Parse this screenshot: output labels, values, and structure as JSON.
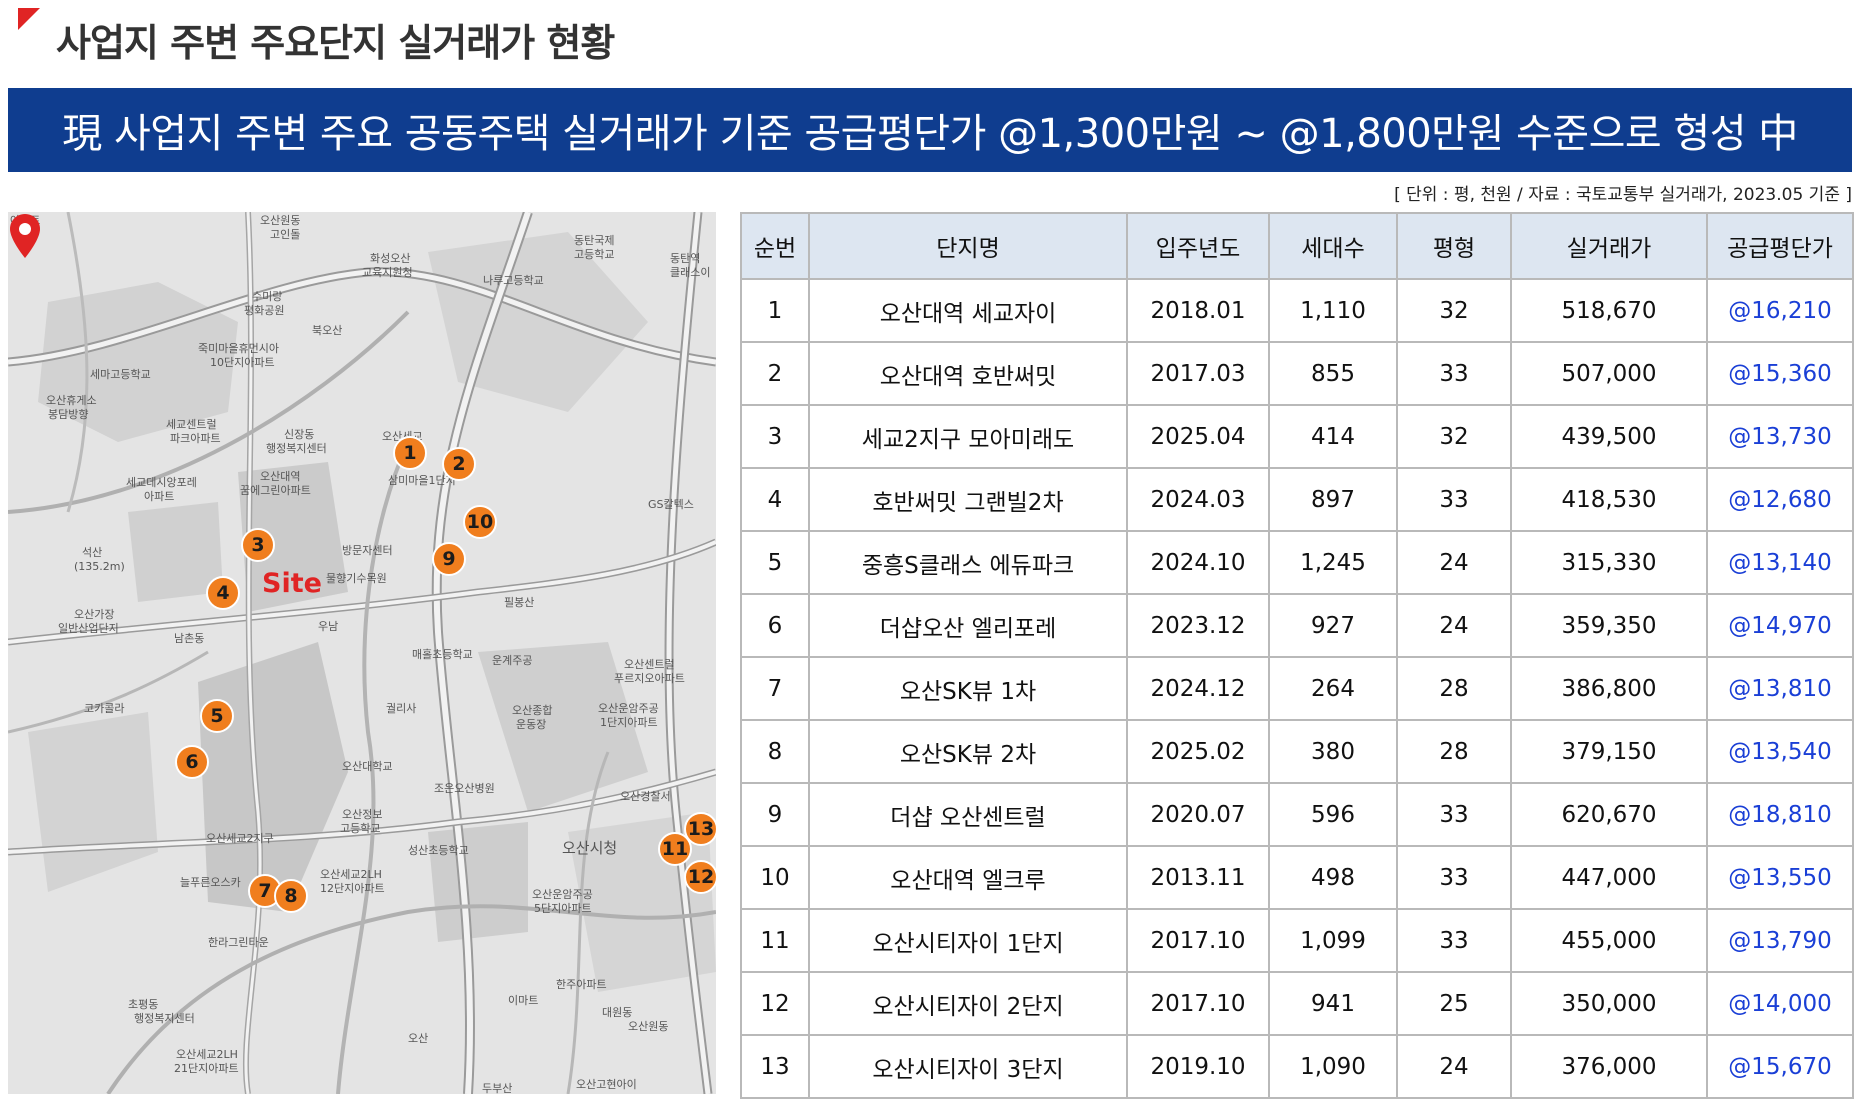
{
  "title": "사업지 주변 주요단지 실거래가 현황",
  "banner": "現 사업지 주변 주요 공동주택 실거래가 기준 공급평단가 @1,300만원 ~ @1,800만원 수준으로 형성 中",
  "source": "[ 단위 : 평, 천원 / 자료 : 국토교통부 실거래가, 2023.05 기준 ]",
  "colors": {
    "accent": "#e02424",
    "banner_bg": "#0f3d8f",
    "header_bg": "#dde6f1",
    "price_text": "#1a3fd6",
    "marker": "#f07e1e"
  },
  "map": {
    "site_label": "Site",
    "markers": [
      "1",
      "2",
      "3",
      "4",
      "5",
      "6",
      "7",
      "8",
      "9",
      "10",
      "11",
      "12",
      "13"
    ],
    "labels": [
      "아파트",
      "오산원동",
      "고인돌",
      "화성오산",
      "교육지원청",
      "나루고등학교",
      "동탄국제",
      "고등학교",
      "동탄역",
      "클래스이",
      "수미랑",
      "평화공원",
      "북오산",
      "세마고등학교",
      "죽미마을휴먼시아",
      "10단지아파트",
      "오산휴게소",
      "봉담방향",
      "세교센트럴",
      "파크아파트",
      "신장동",
      "행정복지센터",
      "오산세교",
      "오산대역",
      "꿈에그린아파트",
      "세교데시앙포레",
      "아파트",
      "삼미마을1단지",
      "GS칼텍스",
      "석산",
      "(135.2m)",
      "방문자센터",
      "물향기수목원",
      "필봉산",
      "오산가장",
      "일반산업단지",
      "남촌동",
      "우남",
      "매홀초등학교",
      "운계주공",
      "오산센트럴",
      "푸르지오아파트",
      "코카콜라",
      "궐리사",
      "오산종합",
      "운동장",
      "오산운암주공",
      "1단지아파트",
      "오산대학교",
      "조은오산병원",
      "오산경찰서",
      "오산정보",
      "고등학교",
      "오산세교2지구",
      "성산초등학교",
      "오산시청",
      "늘푸른오스카",
      "오산세교2LH",
      "12단지아파트",
      "오산운암주공",
      "5단지아파트",
      "한라그린타운",
      "이마트",
      "한주아파트",
      "대원동",
      "초평동",
      "행정복지센터",
      "오산원동",
      "오산",
      "오산세교2LH",
      "21단지아파트",
      "오산고현아이",
      "두부산"
    ]
  },
  "table": {
    "headers": [
      "순번",
      "단지명",
      "입주년도",
      "세대수",
      "평형",
      "실거래가",
      "공급평단가"
    ],
    "rows": [
      [
        "1",
        "오산대역 세교자이",
        "2018.01",
        "1,110",
        "32",
        "518,670",
        "@16,210"
      ],
      [
        "2",
        "오산대역 호반써밋",
        "2017.03",
        "855",
        "33",
        "507,000",
        "@15,360"
      ],
      [
        "3",
        "세교2지구 모아미래도",
        "2025.04",
        "414",
        "32",
        "439,500",
        "@13,730"
      ],
      [
        "4",
        "호반써밋 그랜빌2차",
        "2024.03",
        "897",
        "33",
        "418,530",
        "@12,680"
      ],
      [
        "5",
        "중흥S클래스 에듀파크",
        "2024.10",
        "1,245",
        "24",
        "315,330",
        "@13,140"
      ],
      [
        "6",
        "더샵오산 엘리포레",
        "2023.12",
        "927",
        "24",
        "359,350",
        "@14,970"
      ],
      [
        "7",
        "오산SK뷰 1차",
        "2024.12",
        "264",
        "28",
        "386,800",
        "@13,810"
      ],
      [
        "8",
        "오산SK뷰 2차",
        "2025.02",
        "380",
        "28",
        "379,150",
        "@13,540"
      ],
      [
        "9",
        "더샵 오산센트럴",
        "2020.07",
        "596",
        "33",
        "620,670",
        "@18,810"
      ],
      [
        "10",
        "오산대역 엘크루",
        "2013.11",
        "498",
        "33",
        "447,000",
        "@13,550"
      ],
      [
        "11",
        "오산시티자이 1단지",
        "2017.10",
        "1,099",
        "33",
        "455,000",
        "@13,790"
      ],
      [
        "12",
        "오산시티자이 2단지",
        "2017.10",
        "941",
        "25",
        "350,000",
        "@14,000"
      ],
      [
        "13",
        "오산시티자이 3단지",
        "2019.10",
        "1,090",
        "24",
        "376,000",
        "@15,670"
      ]
    ]
  }
}
